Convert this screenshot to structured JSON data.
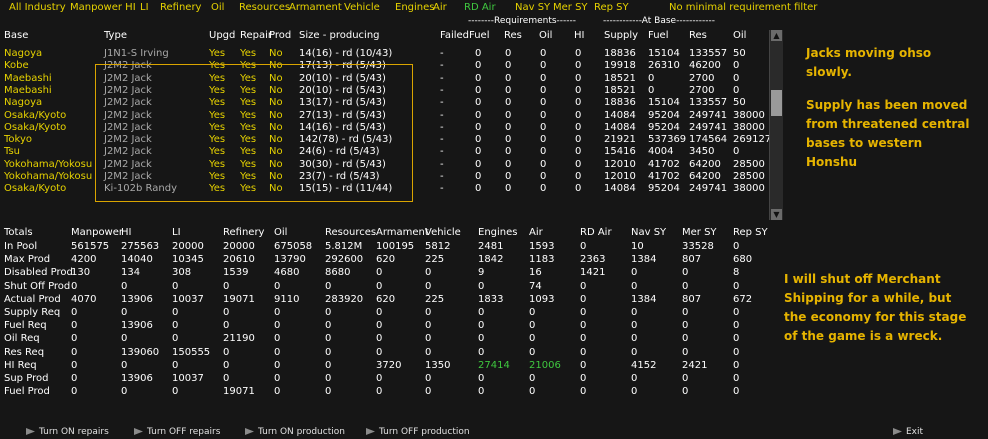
{
  "tabs": [
    "All Industry",
    "Manpower HI",
    "LI",
    "Refinery",
    "Oil",
    "Resources",
    "Armament",
    "Vehicle",
    "Engines",
    "Air",
    "RD Air",
    "Nav SY",
    "Mer SY",
    "Rep SY",
    "No minimal requirement filter"
  ],
  "active_tab": "RD Air",
  "top_columns": {
    "base": "Base",
    "type": "Type",
    "upgd": "Upgd",
    "repair": "Repair",
    "prod": "Prod",
    "size": "Size - producing",
    "failed": "Failed",
    "fuel": "Fuel",
    "res": "Res",
    "oil": "Oil",
    "hi": "HI",
    "supply": "Supply",
    "fuel2": "Fuel",
    "res2": "Res",
    "oil2": "Oil",
    "requirements_banner": "--------Requirements------",
    "atbase_banner": "------------At Base------------"
  },
  "prod_rows": [
    {
      "base": "Nagoya",
      "type": "J1N1-S Irving",
      "upgd": "Yes",
      "repair": "Yes",
      "prod": "No",
      "size": "14(16) - rd (10/43)",
      "failed": "-",
      "fuel": "0",
      "res": "0",
      "oil": "0",
      "hi": "0",
      "supply": "18836",
      "fuel2": "15104",
      "res2": "133557",
      "oil2": "50"
    },
    {
      "base": "Kobe",
      "type": "J2M2 Jack",
      "upgd": "Yes",
      "repair": "Yes",
      "prod": "No",
      "size": "17(13) - rd (5/43)",
      "failed": "-",
      "fuel": "0",
      "res": "0",
      "oil": "0",
      "hi": "0",
      "supply": "19918",
      "fuel2": "26310",
      "res2": "46200",
      "oil2": "0"
    },
    {
      "base": "Maebashi",
      "type": "J2M2 Jack",
      "upgd": "Yes",
      "repair": "Yes",
      "prod": "No",
      "size": "20(10) - rd (5/43)",
      "failed": "-",
      "fuel": "0",
      "res": "0",
      "oil": "0",
      "hi": "0",
      "supply": "18521",
      "fuel2": "0",
      "res2": "2700",
      "oil2": "0"
    },
    {
      "base": "Maebashi",
      "type": "J2M2 Jack",
      "upgd": "Yes",
      "repair": "Yes",
      "prod": "No",
      "size": "20(10) - rd (5/43)",
      "failed": "-",
      "fuel": "0",
      "res": "0",
      "oil": "0",
      "hi": "0",
      "supply": "18521",
      "fuel2": "0",
      "res2": "2700",
      "oil2": "0"
    },
    {
      "base": "Nagoya",
      "type": "J2M2 Jack",
      "upgd": "Yes",
      "repair": "Yes",
      "prod": "No",
      "size": "13(17) - rd (5/43)",
      "failed": "-",
      "fuel": "0",
      "res": "0",
      "oil": "0",
      "hi": "0",
      "supply": "18836",
      "fuel2": "15104",
      "res2": "133557",
      "oil2": "50"
    },
    {
      "base": "Osaka/Kyoto",
      "type": "J2M2 Jack",
      "upgd": "Yes",
      "repair": "Yes",
      "prod": "No",
      "size": "27(13) - rd (5/43)",
      "failed": "-",
      "fuel": "0",
      "res": "0",
      "oil": "0",
      "hi": "0",
      "supply": "14084",
      "fuel2": "95204",
      "res2": "249741",
      "oil2": "38000"
    },
    {
      "base": "Osaka/Kyoto",
      "type": "J2M2 Jack",
      "upgd": "Yes",
      "repair": "Yes",
      "prod": "No",
      "size": "14(16) - rd (5/43)",
      "failed": "-",
      "fuel": "0",
      "res": "0",
      "oil": "0",
      "hi": "0",
      "supply": "14084",
      "fuel2": "95204",
      "res2": "249741",
      "oil2": "38000"
    },
    {
      "base": "Tokyo",
      "type": "J2M2 Jack",
      "upgd": "Yes",
      "repair": "Yes",
      "prod": "No",
      "size": "142(78) - rd (5/43)",
      "failed": "-",
      "fuel": "0",
      "res": "0",
      "oil": "0",
      "hi": "0",
      "supply": "21921",
      "fuel2": "537369",
      "res2": "174564",
      "oil2": "269127"
    },
    {
      "base": "Tsu",
      "type": "J2M2 Jack",
      "upgd": "Yes",
      "repair": "Yes",
      "prod": "No",
      "size": "24(6) - rd (5/43)",
      "failed": "-",
      "fuel": "0",
      "res": "0",
      "oil": "0",
      "hi": "0",
      "supply": "15416",
      "fuel2": "4004",
      "res2": "3450",
      "oil2": "0"
    },
    {
      "base": "Yokohama/Yokosu",
      "type": "J2M2 Jack",
      "upgd": "Yes",
      "repair": "Yes",
      "prod": "No",
      "size": "30(30) - rd (5/43)",
      "failed": "-",
      "fuel": "0",
      "res": "0",
      "oil": "0",
      "hi": "0",
      "supply": "12010",
      "fuel2": "41702",
      "res2": "64200",
      "oil2": "28500"
    },
    {
      "base": "Yokohama/Yokosu",
      "type": "J2M2 Jack",
      "upgd": "Yes",
      "repair": "Yes",
      "prod": "No",
      "size": "23(7) - rd (5/43)",
      "failed": "-",
      "fuel": "0",
      "res": "0",
      "oil": "0",
      "hi": "0",
      "supply": "12010",
      "fuel2": "41702",
      "res2": "64200",
      "oil2": "28500"
    },
    {
      "base": "Osaka/Kyoto",
      "type": "Ki-102b Randy",
      "upgd": "Yes",
      "repair": "Yes",
      "prod": "No",
      "size": "15(15) - rd (11/44)",
      "failed": "-",
      "fuel": "0",
      "res": "0",
      "oil": "0",
      "hi": "0",
      "supply": "14084",
      "fuel2": "95204",
      "res2": "249741",
      "oil2": "38000"
    }
  ],
  "totals_header": [
    "Totals",
    "Manpower",
    "HI",
    "LI",
    "Refinery",
    "Oil",
    "Resources",
    "Armament",
    "Vehicle",
    "Engines",
    "Air",
    "RD Air",
    "Nav SY",
    "Mer SY",
    "Rep SY"
  ],
  "totals_rows": [
    {
      "label": "In Pool",
      "vals": [
        "561575",
        "275563",
        "20000",
        "20000",
        "675058",
        "5.812M",
        "100195",
        "5812",
        "2481",
        "1593",
        "0",
        "10",
        "33528",
        "0"
      ]
    },
    {
      "label": "Max Prod",
      "vals": [
        "4200",
        "14040",
        "10345",
        "20610",
        "13790",
        "292600",
        "620",
        "225",
        "1842",
        "1183",
        "2363",
        "1384",
        "807",
        "680"
      ]
    },
    {
      "label": "Disabled Prod",
      "vals": [
        "130",
        "134",
        "308",
        "1539",
        "4680",
        "8680",
        "0",
        "0",
        "9",
        "16",
        "1421",
        "0",
        "0",
        "8"
      ]
    },
    {
      "label": "Shut Off Prod",
      "vals": [
        "0",
        "0",
        "0",
        "0",
        "0",
        "0",
        "0",
        "0",
        "0",
        "74",
        "0",
        "0",
        "0",
        "0"
      ]
    },
    {
      "label": "Actual Prod",
      "vals": [
        "4070",
        "13906",
        "10037",
        "19071",
        "9110",
        "283920",
        "620",
        "225",
        "1833",
        "1093",
        "0",
        "1384",
        "807",
        "672"
      ]
    },
    {
      "label": "Supply Req",
      "vals": [
        "0",
        "0",
        "0",
        "0",
        "0",
        "0",
        "0",
        "0",
        "0",
        "0",
        "0",
        "0",
        "0",
        "0"
      ]
    },
    {
      "label": "Fuel Req",
      "vals": [
        "0",
        "13906",
        "0",
        "0",
        "0",
        "0",
        "0",
        "0",
        "0",
        "0",
        "0",
        "0",
        "0",
        "0"
      ]
    },
    {
      "label": "Oil Req",
      "vals": [
        "0",
        "0",
        "0",
        "21190",
        "0",
        "0",
        "0",
        "0",
        "0",
        "0",
        "0",
        "0",
        "0",
        "0"
      ]
    },
    {
      "label": "Res Req",
      "vals": [
        "0",
        "139060",
        "150555",
        "0",
        "0",
        "0",
        "0",
        "0",
        "0",
        "0",
        "0",
        "0",
        "0",
        "0"
      ]
    },
    {
      "label": "HI Req",
      "vals": [
        "0",
        "0",
        "0",
        "0",
        "0",
        "0",
        "3720",
        "1350",
        "27414",
        "21006",
        "0",
        "4152",
        "2421",
        "0"
      ]
    },
    {
      "label": "Sup Prod",
      "vals": [
        "0",
        "13906",
        "10037",
        "0",
        "0",
        "0",
        "0",
        "0",
        "0",
        "0",
        "0",
        "0",
        "0",
        "0"
      ]
    },
    {
      "label": "Fuel Prod",
      "vals": [
        "0",
        "0",
        "0",
        "19071",
        "0",
        "0",
        "0",
        "0",
        "0",
        "0",
        "0",
        "0",
        "0",
        "0"
      ]
    }
  ],
  "notes": {
    "note1_line1": "Jacks moving ohso slowly.",
    "note1_line2": "Supply has been moved from threatened central bases to western Honshu",
    "note2": "I will shut off Merchant Shipping for a while, but the economy for this stage of the game is a wreck."
  },
  "footer": {
    "repairs_on": "Turn ON repairs",
    "repairs_off": "Turn OFF repairs",
    "prod_on": "Turn ON production",
    "prod_off": "Turn OFF production",
    "exit": "Exit"
  },
  "colors": {
    "highlight": "#3fc83f",
    "tab": "#e6d200",
    "note": "#e6b400",
    "selection_box": "#d9a400"
  }
}
